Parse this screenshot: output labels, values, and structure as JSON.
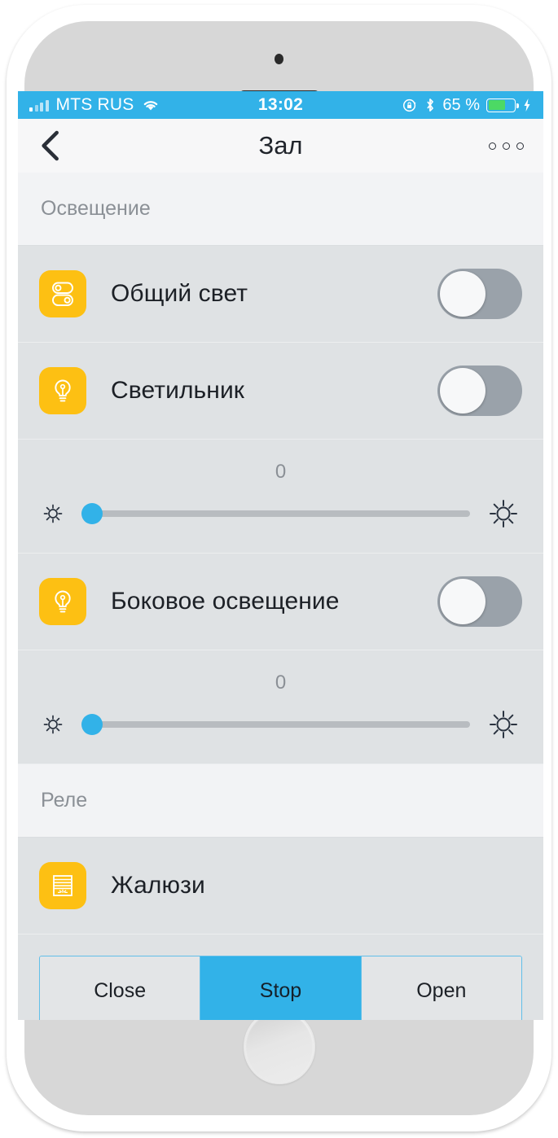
{
  "status_bar": {
    "carrier": "MTS RUS",
    "wifi_icon": "wifi-icon",
    "signal_icon": "signal-bars-icon",
    "time": "13:02",
    "rotation_lock_icon": "rotation-lock-icon",
    "bluetooth_icon": "bluetooth-icon",
    "battery_percent": "65 %",
    "battery_level": 65,
    "charging_icon": "lightning-bolt-icon",
    "background_color": "#32b2e8"
  },
  "nav_bar": {
    "back_icon": "back-chevron-icon",
    "title": "Зал",
    "more_icon": "more-options-icon"
  },
  "sections": [
    {
      "header": "Освещение",
      "rows": [
        {
          "type": "switch",
          "icon": "double-toggle-icon",
          "label": "Общий свет",
          "switch_on": false
        },
        {
          "type": "switch",
          "icon": "light-bulb-icon",
          "label": "Светильник",
          "switch_on": false
        },
        {
          "type": "slider",
          "value": "0",
          "value_number": 0,
          "min": 0,
          "max": 100,
          "left_icon": "brightness-low-icon",
          "right_icon": "brightness-high-icon"
        },
        {
          "type": "switch",
          "icon": "light-bulb-icon",
          "label": "Боковое освещение",
          "switch_on": false
        },
        {
          "type": "slider",
          "value": "0",
          "value_number": 0,
          "min": 0,
          "max": 100,
          "left_icon": "brightness-low-icon",
          "right_icon": "brightness-high-icon"
        }
      ]
    },
    {
      "header": "Реле",
      "rows": [
        {
          "type": "plain",
          "icon": "blinds-icon",
          "label": "Жалюзи"
        }
      ],
      "segmented_control": {
        "options": [
          "Close",
          "Stop",
          "Open"
        ],
        "selected_index": 1
      }
    }
  ],
  "colors": {
    "accent": "#32b2e8",
    "tile": "#fdc013",
    "row_bg": "#dfe2e4",
    "section_bg": "#f2f3f5",
    "switch_off": "#9aa2aa",
    "battery_green": "#4cd964"
  }
}
